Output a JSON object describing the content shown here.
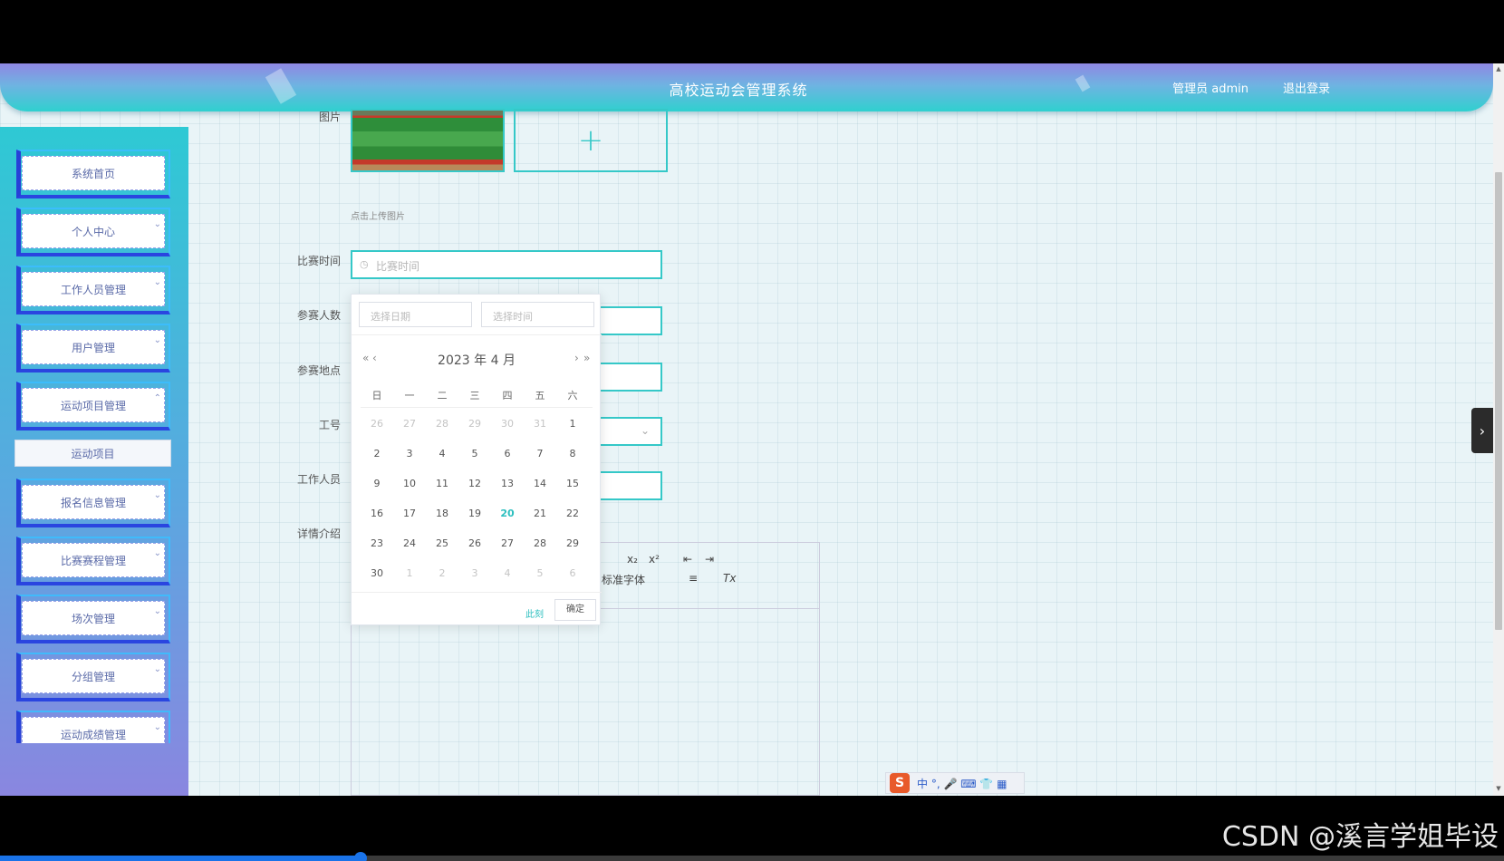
{
  "app": {
    "title": "高校运动会管理系统",
    "user": "管理员 admin",
    "logout": "退出登录"
  },
  "sidebar": {
    "items": [
      {
        "label": "系统首页",
        "chevron": ""
      },
      {
        "label": "个人中心",
        "chevron": "⌄"
      },
      {
        "label": "工作人员管理",
        "chevron": "⌄"
      },
      {
        "label": "用户管理",
        "chevron": "⌄"
      },
      {
        "label": "运动项目管理",
        "chevron": "⌃"
      },
      {
        "label": "报名信息管理",
        "chevron": "⌄"
      },
      {
        "label": "比赛赛程管理",
        "chevron": "⌄"
      },
      {
        "label": "场次管理",
        "chevron": "⌄"
      },
      {
        "label": "分组管理",
        "chevron": "⌄"
      },
      {
        "label": "运动成绩管理",
        "chevron": "⌄"
      }
    ],
    "submenu": {
      "label": "运动项目"
    }
  },
  "form": {
    "labels": {
      "image": "图片",
      "time": "比赛时间",
      "count": "参赛人数",
      "place": "参赛地点",
      "staff_no": "工号",
      "staff": "工作人员",
      "detail": "详情介绍"
    },
    "upload_tip": "点击上传图片",
    "time_placeholder": "比赛时间"
  },
  "datepicker": {
    "date_placeholder": "选择日期",
    "time_placeholder": "选择时间",
    "year_label": "2023 年",
    "month_label": "4 月",
    "prev_year": "«",
    "prev_month": "‹",
    "next_month": "›",
    "next_year": "»",
    "weekdays": [
      "日",
      "一",
      "二",
      "三",
      "四",
      "五",
      "六"
    ],
    "weeks": [
      [
        "26",
        "27",
        "28",
        "29",
        "30",
        "31",
        "1"
      ],
      [
        "2",
        "3",
        "4",
        "5",
        "6",
        "7",
        "8"
      ],
      [
        "9",
        "10",
        "11",
        "12",
        "13",
        "14",
        "15"
      ],
      [
        "16",
        "17",
        "18",
        "19",
        "20",
        "21",
        "22"
      ],
      [
        "23",
        "24",
        "25",
        "26",
        "27",
        "28",
        "29"
      ],
      [
        "30",
        "1",
        "2",
        "3",
        "4",
        "5",
        "6"
      ]
    ],
    "today": "20",
    "now_label": "此刻",
    "ok_label": "确定"
  },
  "editor": {
    "toolbar": [
      "x₂",
      "x²",
      "⇤",
      "⇥",
      "标准字体",
      "≡",
      "Tx"
    ]
  },
  "ime": {
    "logo": "S",
    "text": "中 °, 🎤 ⌨ 👕 ▦"
  },
  "watermark": "CSDN @溪言学姐毕设"
}
